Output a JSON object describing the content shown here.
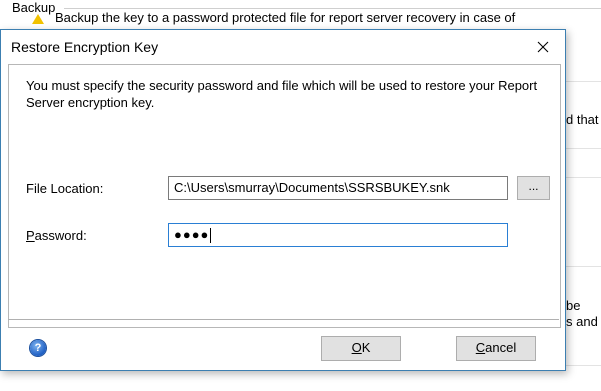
{
  "background": {
    "group_label": "Backup",
    "warning_text": "Backup the key to a password protected file for report server recovery in case of",
    "side_text_1": "d that",
    "side_text_2": "be",
    "side_text_3": "s and"
  },
  "dialog": {
    "title": "Restore Encryption Key",
    "close_icon": "close-icon",
    "instructions": "You must specify the security password and file which will be used to restore your Report Server encryption key.",
    "file_location": {
      "label": "File Location:",
      "value": "C:\\Users\\smurray\\Documents\\SSRSBUKEY.snk",
      "browse_label": "..."
    },
    "password": {
      "label_access_key": "P",
      "label_rest": "assword:",
      "masked_value": "●●●●"
    },
    "help_icon": "help-icon",
    "ok": {
      "access_key": "O",
      "rest": "K"
    },
    "cancel": {
      "access_key": "C",
      "rest": "ancel"
    },
    "colors": {
      "border": "#3c7fb1",
      "focus": "#2a7fd4"
    }
  }
}
